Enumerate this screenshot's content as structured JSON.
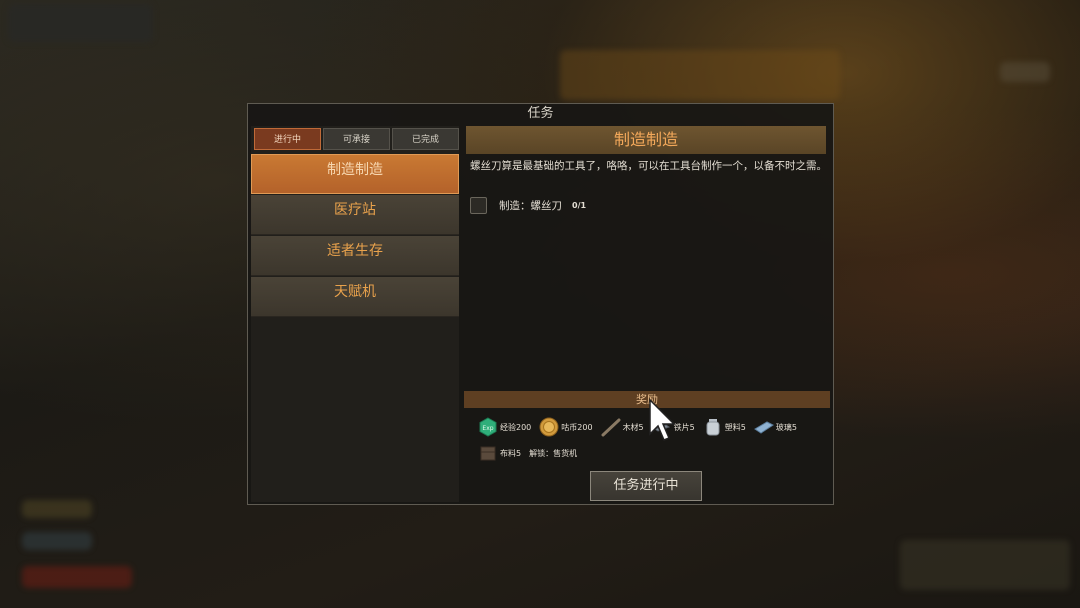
{
  "panel": {
    "title": "任务"
  },
  "tabs": [
    {
      "label": "进行中",
      "active": true
    },
    {
      "label": "可承接",
      "active": false
    },
    {
      "label": "已完成",
      "active": false
    }
  ],
  "quests": [
    {
      "label": "制造制造",
      "selected": true
    },
    {
      "label": "医疗站",
      "selected": false
    },
    {
      "label": "适者生存",
      "selected": false
    },
    {
      "label": "天赋机",
      "selected": false
    }
  ],
  "detail": {
    "title": "制造制造",
    "description": "螺丝刀算是最基础的工具了，咯咯，可以在工具台制作一个，以备不时之需。",
    "objective": {
      "label": "制造：螺丝刀",
      "count": "0/1",
      "done": false
    }
  },
  "rewards": {
    "header": "奖励",
    "items": [
      {
        "icon": "exp-icon",
        "text": "经验200"
      },
      {
        "icon": "coin-icon",
        "text": "咕币200"
      },
      {
        "icon": "wood-icon",
        "text": "木材5"
      },
      {
        "icon": "iron-plate-icon",
        "text": "铁片5"
      },
      {
        "icon": "plastic-icon",
        "text": "塑料5"
      },
      {
        "icon": "glass-icon",
        "text": "玻璃5"
      },
      {
        "icon": "cloth-icon",
        "text": "布料5"
      },
      {
        "icon": "",
        "text": "解锁：售货机"
      }
    ]
  },
  "status_button": {
    "label": "任务进行中"
  },
  "colors": {
    "accent": "#c97933",
    "text_orange": "#e9a24c",
    "panel_bg": "#181714"
  }
}
